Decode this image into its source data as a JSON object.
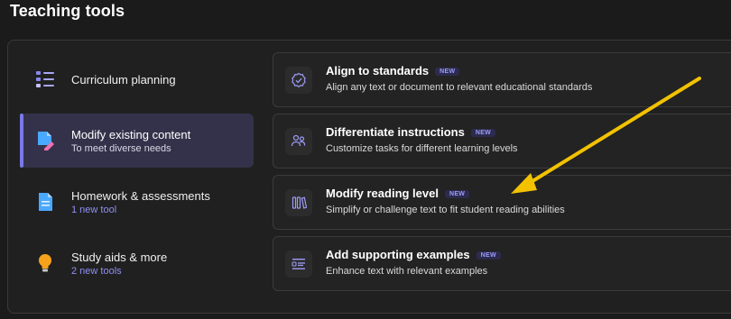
{
  "page": {
    "title": "Teaching tools"
  },
  "sidebar": {
    "items": [
      {
        "icon": "list-icon",
        "title": "Curriculum planning",
        "subtitle": ""
      },
      {
        "icon": "edit-document-icon",
        "title": "Modify existing content",
        "subtitle": "To meet diverse needs",
        "active": true
      },
      {
        "icon": "document-icon",
        "title": "Homework & assessments",
        "subtitle": "1 new tool"
      },
      {
        "icon": "lightbulb-icon",
        "title": "Study aids & more",
        "subtitle": "2 new tools"
      }
    ]
  },
  "tools": [
    {
      "icon": "badge-check-icon",
      "title": "Align to standards",
      "badge": "NEW",
      "description": "Align any text or document to relevant educational standards"
    },
    {
      "icon": "people-icon",
      "title": "Differentiate instructions",
      "badge": "NEW",
      "description": "Customize tasks for different learning levels"
    },
    {
      "icon": "reading-level-icon",
      "title": "Modify reading level",
      "badge": "NEW",
      "description": "Simplify or challenge text to fit student reading abilities"
    },
    {
      "icon": "text-example-icon",
      "title": "Add supporting examples",
      "badge": "NEW",
      "description": "Enhance text with relevant examples"
    }
  ],
  "colors": {
    "accent": "#7b78e8",
    "link": "#8f8ff5",
    "annotation_arrow": "#f2c200",
    "background": "#1b1b1b"
  }
}
